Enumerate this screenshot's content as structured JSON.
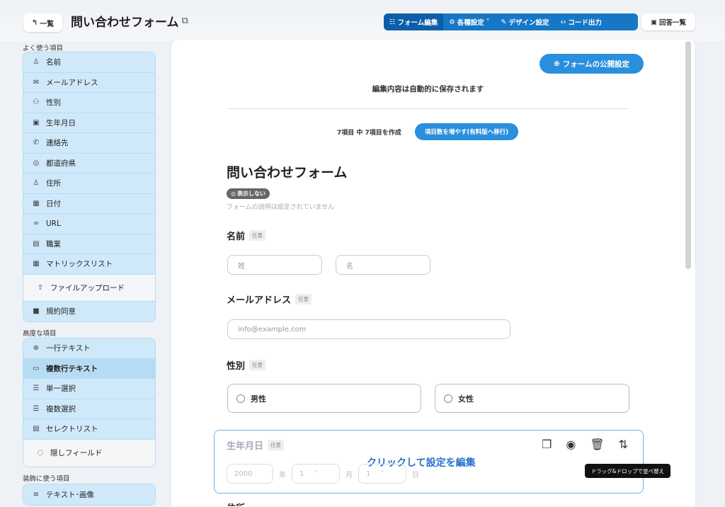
{
  "header": {
    "back_label": "一覧",
    "title": "問い合わせフォーム",
    "tabs": [
      {
        "label": "フォーム編集",
        "icon": "list-icon"
      },
      {
        "label": "各種設定",
        "icon": "settings-icon"
      },
      {
        "label": "デザイン設定",
        "icon": "pen-icon"
      },
      {
        "label": "コード出力",
        "icon": "code-icon"
      }
    ],
    "answers_label": "回答一覧"
  },
  "sidebar": {
    "section_common": "よく使う項目",
    "common_items": [
      {
        "label": "名前",
        "icon": "person-icon"
      },
      {
        "label": "メールアドレス",
        "icon": "mail-icon"
      },
      {
        "label": "性別",
        "icon": "people-icon"
      },
      {
        "label": "生年月日",
        "icon": "calendar-icon"
      },
      {
        "label": "連絡先",
        "icon": "phone-icon"
      },
      {
        "label": "都道府県",
        "icon": "pin-icon"
      },
      {
        "label": "住所",
        "icon": "home-person-icon"
      },
      {
        "label": "日付",
        "icon": "date-icon"
      },
      {
        "label": "URL",
        "icon": "link-icon"
      },
      {
        "label": "職業",
        "icon": "badge-icon"
      },
      {
        "label": "マトリックスリスト",
        "icon": "table-icon"
      },
      {
        "label": "ファイルアップロード",
        "icon": "upload-icon"
      },
      {
        "label": "規約同意",
        "icon": "clipboard-icon"
      }
    ],
    "section_advanced": "高度な項目",
    "advanced_items": [
      {
        "label": "一行テキスト",
        "icon": "text-line-icon"
      },
      {
        "label": "複数行テキスト",
        "icon": "textarea-icon"
      },
      {
        "label": "単一選択",
        "icon": "radio-list-icon"
      },
      {
        "label": "複数選択",
        "icon": "check-list-icon"
      },
      {
        "label": "セレクトリスト",
        "icon": "select-icon"
      },
      {
        "label": "隠しフィールド",
        "icon": "eye-off-icon"
      }
    ],
    "section_decor": "装飾に使う項目",
    "decor_items": [
      {
        "label": "テキスト･画像",
        "icon": "text-image-icon"
      }
    ]
  },
  "main": {
    "publish_label": "フォームの公開設定",
    "autosave_text": "編集内容は自動的に保存されます",
    "count_text": "7項目 中 7項目を作成",
    "upgrade_label": "項目数を増やす(有料版へ移行)",
    "form_title": "問い合わせフォーム",
    "hidden_badge": "表示しない",
    "form_description": "フォームの説明は設定されていません",
    "optional_badge": "任意",
    "fields": {
      "name": {
        "label": "名前",
        "last_placeholder": "姓",
        "first_placeholder": "名"
      },
      "email": {
        "label": "メールアドレス",
        "placeholder": "info@example.com"
      },
      "gender": {
        "label": "性別",
        "options": [
          "男性",
          "女性"
        ]
      },
      "birthday": {
        "label": "生年月日",
        "year_placeholder": "2000",
        "year_unit": "年",
        "month_value": "1",
        "month_unit": "月",
        "day_value": "1",
        "day_unit": "日"
      },
      "address": {
        "label": "住所"
      }
    },
    "edit_hint": "クリックして設定を編集",
    "tooltip": "ドラッグ&ドロップで並べ替え"
  }
}
